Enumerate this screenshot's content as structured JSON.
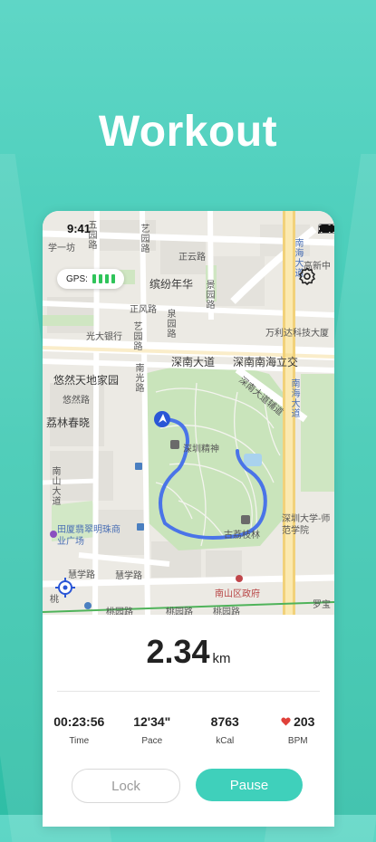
{
  "headline": "Workout",
  "status_bar": {
    "time": "9:41"
  },
  "gps": {
    "label": "GPS:",
    "bars": 4
  },
  "map": {
    "labels": {
      "xuetang": "学一坊",
      "wuyuanlu": "五园路",
      "yiyuanlu": "艺园路",
      "zhengyunlu": "正云路",
      "binfen": "缤纷年华",
      "jingyuanlu": "景园路",
      "nanhaidadao": "南海大道",
      "gaoxin": "高新中",
      "zhengfenglu": "正风路",
      "quanyuanlu": "泉园路",
      "guangda": "光大银行",
      "yiyuanlu2": "艺园路",
      "wanlida": "万利达科技大厦",
      "shennan": "深南大道",
      "shennan2": "深南南海立交",
      "youran": "悠然天地家园",
      "youran2": "悠然路",
      "nanguanglu": "南光路",
      "lilin": "荔林春晓",
      "shenzhenjingshen": "深圳精神",
      "shennandadaojudao": "深南大道辅道",
      "nanhaidadao2": "南海大道",
      "nanshandadao": "南山大道",
      "tianxia": "田厦翡翠明珠商业广场",
      "shendashifan": "深圳大学-师范学院",
      "gulin": "古荔枝林",
      "huixuelu": "慧学路",
      "huixuelu2": "慧学路",
      "nanshanzhengfu": "南山区政府",
      "taoyuan": "桃园路",
      "taoyuan2": "桃园路",
      "taoyuan3": "桃园路",
      "taoyuan_left": "桃",
      "luobao": "罗宝"
    }
  },
  "distance": {
    "value": "2.34",
    "unit": "km"
  },
  "stats": [
    {
      "value": "00:23:56",
      "label": "Time"
    },
    {
      "value": "12'34\"",
      "label": "Pace"
    },
    {
      "value": "8763",
      "label": "kCal"
    },
    {
      "value": "203",
      "label": "BPM"
    }
  ],
  "buttons": {
    "lock": "Lock",
    "pause": "Pause"
  },
  "colors": {
    "accent": "#3fd0bb",
    "route": "#4a74e8",
    "heart": "#e0413a",
    "gps_bar": "#2fc45a"
  }
}
